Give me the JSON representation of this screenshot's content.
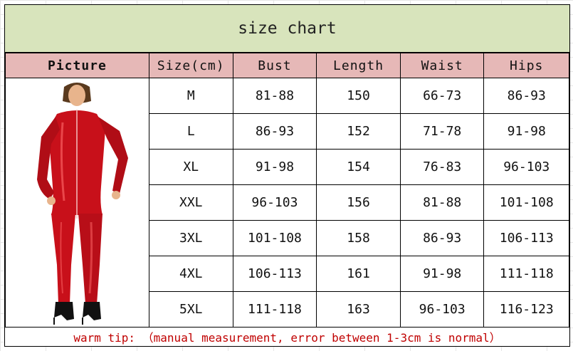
{
  "title": "size chart",
  "headers": [
    "Picture",
    "Size(cm)",
    "Bust",
    "Length",
    "Waist",
    "Hips"
  ],
  "rows": [
    {
      "size": "M",
      "bust": "81-88",
      "length": "150",
      "waist": "66-73",
      "hips": "86-93"
    },
    {
      "size": "L",
      "bust": "86-93",
      "length": "152",
      "waist": "71-78",
      "hips": "91-98"
    },
    {
      "size": "XL",
      "bust": "91-98",
      "length": "154",
      "waist": "76-83",
      "hips": "96-103"
    },
    {
      "size": "XXL",
      "bust": "96-103",
      "length": "156",
      "waist": "81-88",
      "hips": "101-108"
    },
    {
      "size": "3XL",
      "bust": "101-108",
      "length": "158",
      "waist": "86-93",
      "hips": "106-113"
    },
    {
      "size": "4XL",
      "bust": "106-113",
      "length": "161",
      "waist": "91-98",
      "hips": "111-118"
    },
    {
      "size": "5XL",
      "bust": "111-118",
      "length": "163",
      "waist": "96-103",
      "hips": "116-123"
    }
  ],
  "tip": "warm tip: （manual measurement, error between 1-3cm is normal）",
  "colors": {
    "title_bg": "#d8e4bc",
    "header_bg": "#e6b8b7",
    "tip_text": "#c00000",
    "garment": "#c8101a"
  }
}
